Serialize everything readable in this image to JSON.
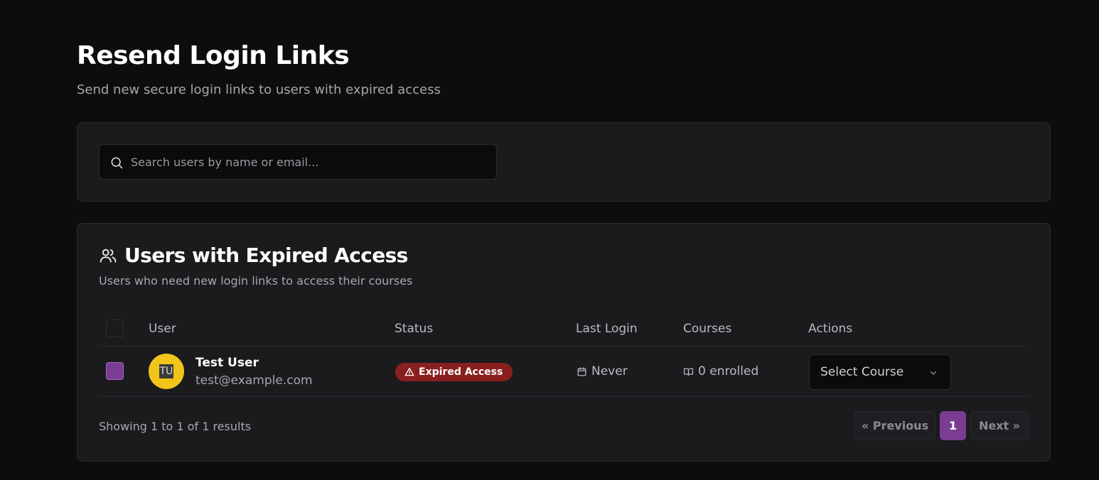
{
  "page": {
    "title": "Resend Login Links",
    "subtitle": "Send new secure login links to users with expired access"
  },
  "search": {
    "placeholder": "Search users by name or email...",
    "value": "",
    "icon": "search-icon"
  },
  "users_section": {
    "title": "Users with Expired Access",
    "description": "Users who need new login links to access their courses",
    "icon": "users-icon",
    "columns": [
      "User",
      "Status",
      "Last Login",
      "Courses",
      "Actions"
    ],
    "rows": [
      {
        "selected": true,
        "initials": "TU",
        "name": "Test User",
        "email": "test@example.com",
        "status": "Expired Access",
        "last_login": "Never",
        "courses": "0 enrolled",
        "action_select": "Select Course"
      }
    ]
  },
  "pagination": {
    "summary": "Showing 1 to 1 of 1 results",
    "prev_label": "« Previous",
    "current_page": "1",
    "next_label": "Next »"
  },
  "colors": {
    "background": "#0e0c0c",
    "card": "#1b1b1e",
    "accent": "#7a3d93",
    "status_expired": "#8a1f1f",
    "avatar": "#f0c419"
  }
}
